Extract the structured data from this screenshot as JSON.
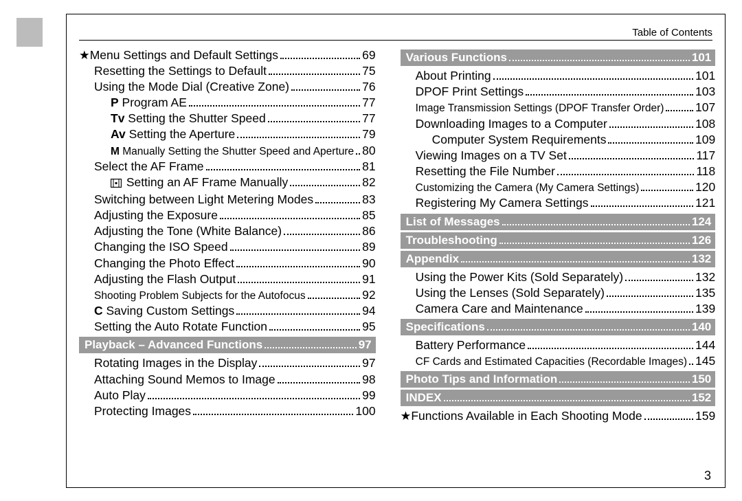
{
  "header": {
    "title": "Table of Contents"
  },
  "page_number": "3",
  "left": [
    {
      "type": "entry",
      "prefix": "★",
      "label": "Menu Settings and Default Settings",
      "page": "69",
      "indent": 0
    },
    {
      "type": "entry",
      "label": "Resetting the Settings to Default",
      "page": "75",
      "indent": 1
    },
    {
      "type": "entry",
      "label": "Using the Mode Dial (Creative Zone)",
      "page": "76",
      "indent": 1
    },
    {
      "type": "entry",
      "prefixBold": "P",
      "label": " Program AE",
      "page": "77",
      "indent": 2
    },
    {
      "type": "entry",
      "prefixBold": "Tv",
      "label": " Setting the Shutter Speed",
      "page": "77",
      "indent": 2
    },
    {
      "type": "entry",
      "prefixBold": "Av",
      "label": " Setting the Aperture",
      "page": "79",
      "indent": 2
    },
    {
      "type": "entry",
      "prefixBold": "M",
      "label": " Manually Setting the Shutter Speed and Aperture",
      "page": "80",
      "indent": 2,
      "small": true
    },
    {
      "type": "entry",
      "label": "Select the AF Frame",
      "page": "81",
      "indent": 1
    },
    {
      "type": "entry",
      "icon": "af-frame-icon",
      "label": " Setting an AF Frame Manually",
      "page": "82",
      "indent": 2
    },
    {
      "type": "entry",
      "label": "Switching between Light Metering Modes",
      "page": "83",
      "indent": 1
    },
    {
      "type": "entry",
      "label": "Adjusting the Exposure",
      "page": "85",
      "indent": 1
    },
    {
      "type": "entry",
      "label": "Adjusting the Tone (White Balance)",
      "page": "86",
      "indent": 1
    },
    {
      "type": "entry",
      "label": "Changing the ISO Speed",
      "page": "89",
      "indent": 1
    },
    {
      "type": "entry",
      "label": "Changing the Photo Effect",
      "page": "90",
      "indent": 1
    },
    {
      "type": "entry",
      "label": "Adjusting the Flash Output",
      "page": "91",
      "indent": 1
    },
    {
      "type": "entry",
      "label": "Shooting Problem Subjects for the Autofocus",
      "page": "92",
      "indent": 1,
      "small": true
    },
    {
      "type": "entry",
      "prefixBold": "C",
      "label": " Saving Custom Settings",
      "page": "94",
      "indent": 1
    },
    {
      "type": "entry",
      "label": "Setting the Auto Rotate Function",
      "page": "95",
      "indent": 1
    },
    {
      "type": "section",
      "label": "Playback – Advanced Functions",
      "page": "97"
    },
    {
      "type": "entry",
      "label": "Rotating Images in the Display",
      "page": "97",
      "indent": 1
    },
    {
      "type": "entry",
      "label": "Attaching Sound Memos to Image",
      "page": "98",
      "indent": 1
    },
    {
      "type": "entry",
      "label": "Auto Play",
      "page": "99",
      "indent": 1
    },
    {
      "type": "entry",
      "label": "Protecting Images",
      "page": "100",
      "indent": 1
    }
  ],
  "right": [
    {
      "type": "section",
      "label": "Various Functions",
      "page": "101"
    },
    {
      "type": "entry",
      "label": "About Printing",
      "page": "101",
      "indent": 1
    },
    {
      "type": "entry",
      "label": "DPOF Print Settings",
      "page": "103",
      "indent": 1
    },
    {
      "type": "entry",
      "label": "Image Transmission Settings (DPOF Transfer Order)",
      "page": "107",
      "indent": 1,
      "small": true
    },
    {
      "type": "entry",
      "label": "Downloading Images to a Computer",
      "page": "108",
      "indent": 1
    },
    {
      "type": "entry",
      "label": "Computer System Requirements",
      "page": "109",
      "indent": 2
    },
    {
      "type": "entry",
      "label": "Viewing Images on a TV Set",
      "page": "117",
      "indent": 1
    },
    {
      "type": "entry",
      "label": "Resetting the File Number",
      "page": "118",
      "indent": 1
    },
    {
      "type": "entry",
      "label": "Customizing the Camera (My Camera Settings)",
      "page": "120",
      "indent": 1,
      "small": true
    },
    {
      "type": "entry",
      "label": "Registering My Camera Settings",
      "page": "121",
      "indent": 1
    },
    {
      "type": "section",
      "label": "List of Messages",
      "page": "124"
    },
    {
      "type": "section",
      "label": "Troubleshooting",
      "page": "126"
    },
    {
      "type": "section",
      "label": "Appendix",
      "page": "132"
    },
    {
      "type": "entry",
      "label": "Using the Power Kits (Sold Separately)",
      "page": "132",
      "indent": 1
    },
    {
      "type": "entry",
      "label": "Using the Lenses (Sold Separately)",
      "page": "135",
      "indent": 1
    },
    {
      "type": "entry",
      "label": "Camera Care and Maintenance",
      "page": "139",
      "indent": 1
    },
    {
      "type": "section",
      "label": "Specifications",
      "page": "140"
    },
    {
      "type": "entry",
      "label": "Battery Performance",
      "page": "144",
      "indent": 1
    },
    {
      "type": "entry",
      "label": "CF Cards and Estimated Capacities (Recordable Images)",
      "page": "145",
      "indent": 1,
      "small": true
    },
    {
      "type": "section",
      "label": "Photo Tips and Information",
      "page": "150"
    },
    {
      "type": "section",
      "label": "INDEX",
      "page": "152"
    },
    {
      "type": "entry",
      "prefix": "★",
      "label": "Functions Available in Each Shooting Mode",
      "page": "159",
      "indent": 0
    }
  ]
}
